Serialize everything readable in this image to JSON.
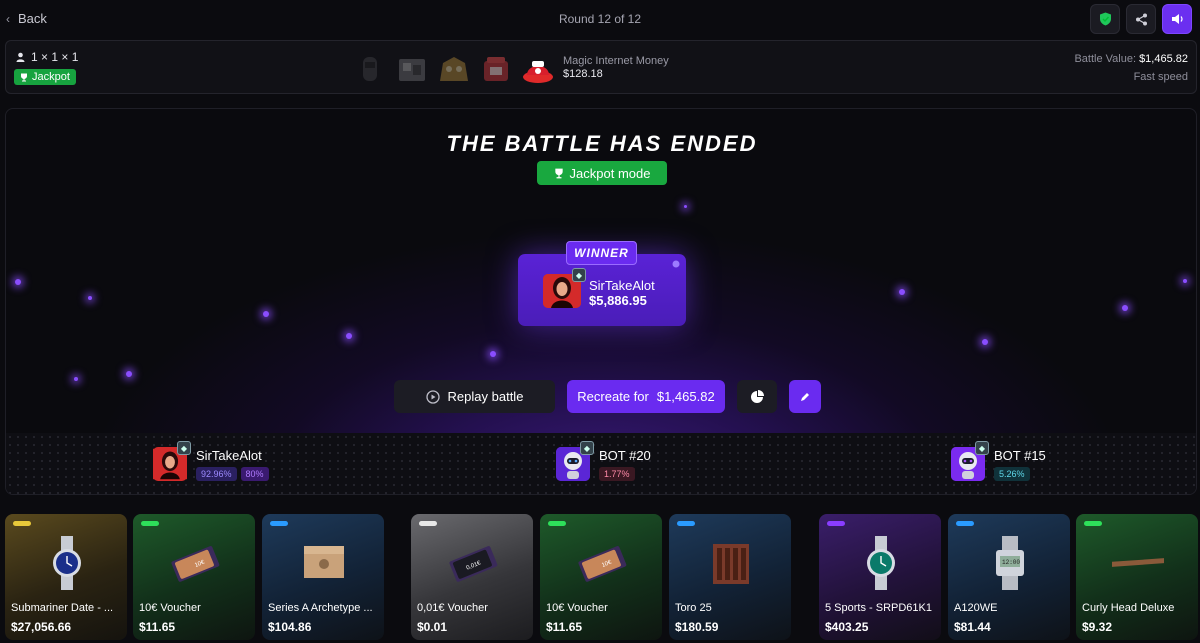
{
  "topbar": {
    "back_label": "Back",
    "round_label": "Round 12 of 12"
  },
  "info": {
    "mode": "1 × 1 × 1",
    "jackpot_label": "Jackpot",
    "case_name": "Magic Internet Money",
    "case_price": "$128.18",
    "battle_value_label": "Battle Value:",
    "battle_value": "$1,465.82",
    "speed": "Fast speed"
  },
  "stage": {
    "title": "THE BATTLE HAS ENDED",
    "mode_pill": "Jackpot mode",
    "winner": {
      "label": "WINNER",
      "name": "SirTakeAlot",
      "amount": "$5,886.95"
    },
    "replay_label": "Replay battle",
    "recreate_label": "Recreate for",
    "recreate_price": "$1,465.82"
  },
  "players": [
    {
      "name": "SirTakeAlot",
      "badge1": "92.96%",
      "badge2": "80%"
    },
    {
      "name": "BOT #20",
      "badge1": "1.77%"
    },
    {
      "name": "BOT #15",
      "badge1": "5.26%"
    }
  ],
  "items": [
    {
      "name": "Submariner Date - ...",
      "price": "$27,056.66",
      "rarity": "#e8c93a"
    },
    {
      "name": "10€ Voucher",
      "price": "$11.65",
      "rarity": "#2ee05a"
    },
    {
      "name": "Series A Archetype ...",
      "price": "$104.86",
      "rarity": "#2a9bff"
    },
    {
      "name": "0,01€ Voucher",
      "price": "$0.01",
      "rarity": "#e8e8e8"
    },
    {
      "name": "10€ Voucher",
      "price": "$11.65",
      "rarity": "#2ee05a"
    },
    {
      "name": "Toro 25",
      "price": "$180.59",
      "rarity": "#2a9bff"
    },
    {
      "name": "5 Sports - SRPD61K1",
      "price": "$403.25",
      "rarity": "#8a3dff"
    },
    {
      "name": "A120WE",
      "price": "$81.44",
      "rarity": "#2a9bff"
    },
    {
      "name": "Curly Head Deluxe",
      "price": "$9.32",
      "rarity": "#2ee05a"
    }
  ],
  "colors": {
    "accent": "#6a2bf0",
    "jackpot_green": "#19a83f"
  }
}
